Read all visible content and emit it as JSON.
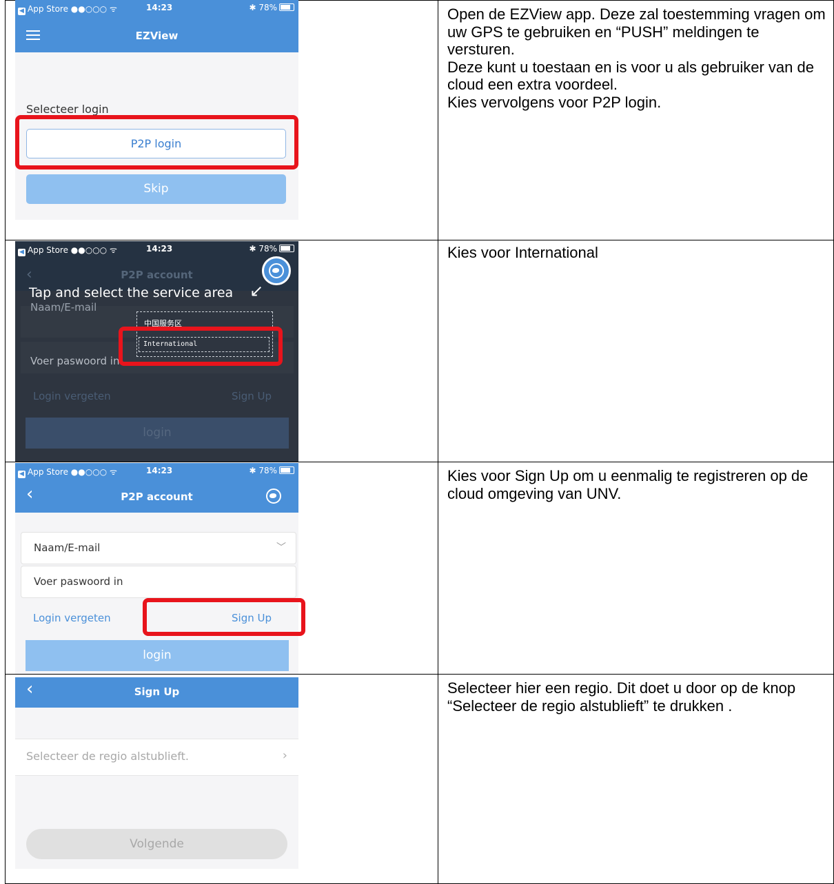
{
  "rows": [
    {
      "phone": {
        "status": {
          "carrier": "App Store ●●○○○ ᯤ",
          "time": "14:23",
          "battery": "✱ 78%"
        },
        "nav_title": "EZView",
        "prompt": "Selecteer login",
        "primary_button": "P2P login",
        "secondary_button": "Skip"
      },
      "description": [
        "Open de EZView app. Deze zal toestemming vragen om uw GPS te gebruiken en “PUSH” meldingen te versturen.",
        "Deze kunt u toestaan en is voor u als gebruiker van de cloud een extra voordeel.",
        "Kies vervolgens voor P2P login."
      ]
    },
    {
      "phone": {
        "status": {
          "carrier": "App Store ●●○○○ ᯤ",
          "time": "14:23",
          "battery": "✱ 78%"
        },
        "nav_title": "P2P account",
        "hint": "Tap and select the service area",
        "name_placeholder": "Naam/E-mail",
        "password_placeholder": "Voer paswoord in",
        "region_options": [
          "中国服务区",
          "International"
        ],
        "forgot_label": "Login vergeten",
        "signup_label": "Sign Up",
        "login_label": "login"
      },
      "description": [
        "Kies voor International"
      ]
    },
    {
      "phone": {
        "status": {
          "carrier": "App Store ●●○○○ ᯤ",
          "time": "14:23",
          "battery": "✱ 78%"
        },
        "nav_title": "P2P account",
        "name_placeholder": "Naam/E-mail",
        "password_placeholder": "Voer paswoord in",
        "forgot_label": "Login vergeten",
        "signup_label": "Sign Up",
        "login_label": "login"
      },
      "description": [
        "Kies voor Sign Up om u eenmalig te registreren op de cloud omgeving van UNV."
      ]
    },
    {
      "phone": {
        "nav_title": "Sign Up",
        "region_placeholder": "Selecteer de regio alstublieft.",
        "next_label": "Volgende"
      },
      "description": [
        "Selecteer hier een regio. Dit doet u door op de knop “Selecteer de regio alstublieft” te drukken ."
      ]
    }
  ],
  "colors": {
    "nav_blue": "#4a90d9",
    "highlight_red": "#e8141c",
    "button_light_blue": "#8fc0f0"
  }
}
